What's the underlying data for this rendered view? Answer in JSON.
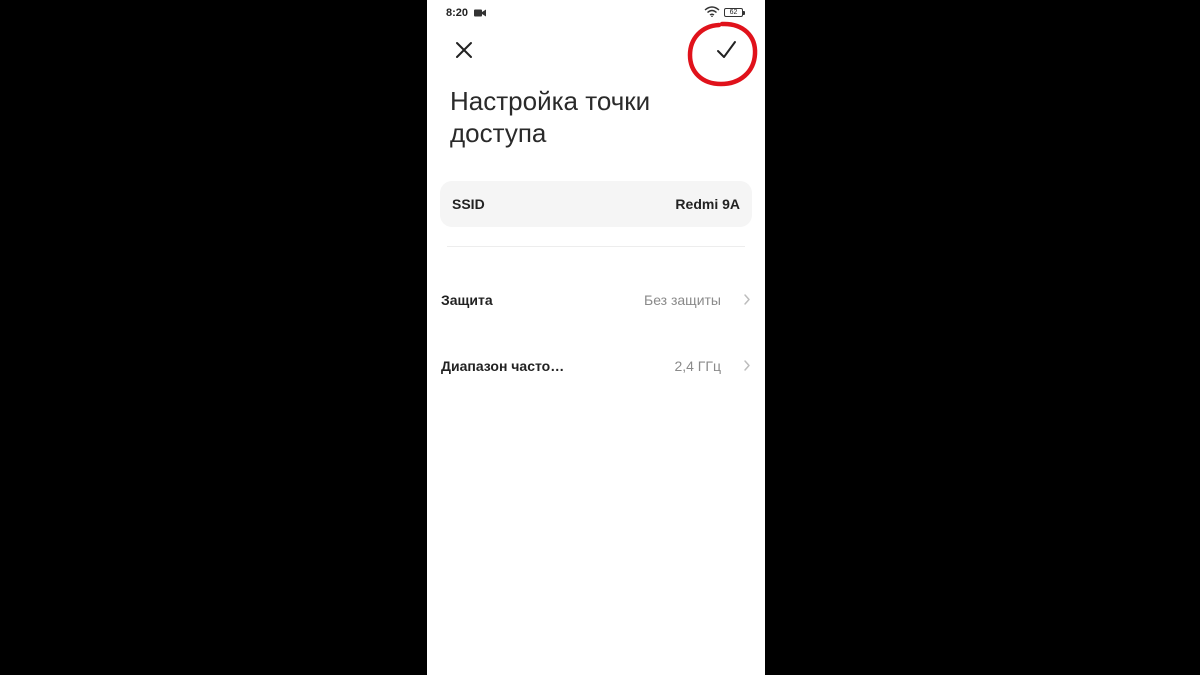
{
  "status_bar": {
    "time": "8:20",
    "battery": "62",
    "icons": [
      "video-camera-icon",
      "wifi-icon",
      "battery-icon"
    ]
  },
  "header": {
    "close_icon": "close-icon",
    "confirm_icon": "checkmark-icon",
    "highlight_color": "#e0121b"
  },
  "title": {
    "line1": "Настройка точки",
    "line2": "доступа"
  },
  "ssid": {
    "label": "SSID",
    "value": "Redmi 9A"
  },
  "settings": [
    {
      "label": "Защита",
      "value": "Без защиты"
    },
    {
      "label": "Диапазон часто…",
      "value": "2,4 ГГц"
    }
  ]
}
